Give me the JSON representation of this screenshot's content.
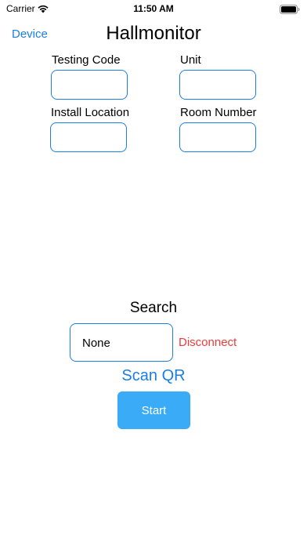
{
  "status_bar": {
    "carrier": "Carrier",
    "time": "11:50 AM"
  },
  "nav": {
    "device_label": "Device",
    "title": "Hallmonitor"
  },
  "form": {
    "testing_code_label": "Testing Code",
    "testing_code_value": "",
    "unit_label": "Unit",
    "unit_value": "",
    "install_location_label": "Install Location",
    "install_location_value": "",
    "room_number_label": "Room Number",
    "room_number_value": ""
  },
  "search": {
    "label": "Search",
    "value": "None",
    "disconnect_label": "Disconnect",
    "scan_qr_label": "Scan QR",
    "start_label": "Start"
  },
  "colors": {
    "accent": "#1a7ee6",
    "danger": "#f03a3a",
    "button_bg": "#3aabf7"
  }
}
